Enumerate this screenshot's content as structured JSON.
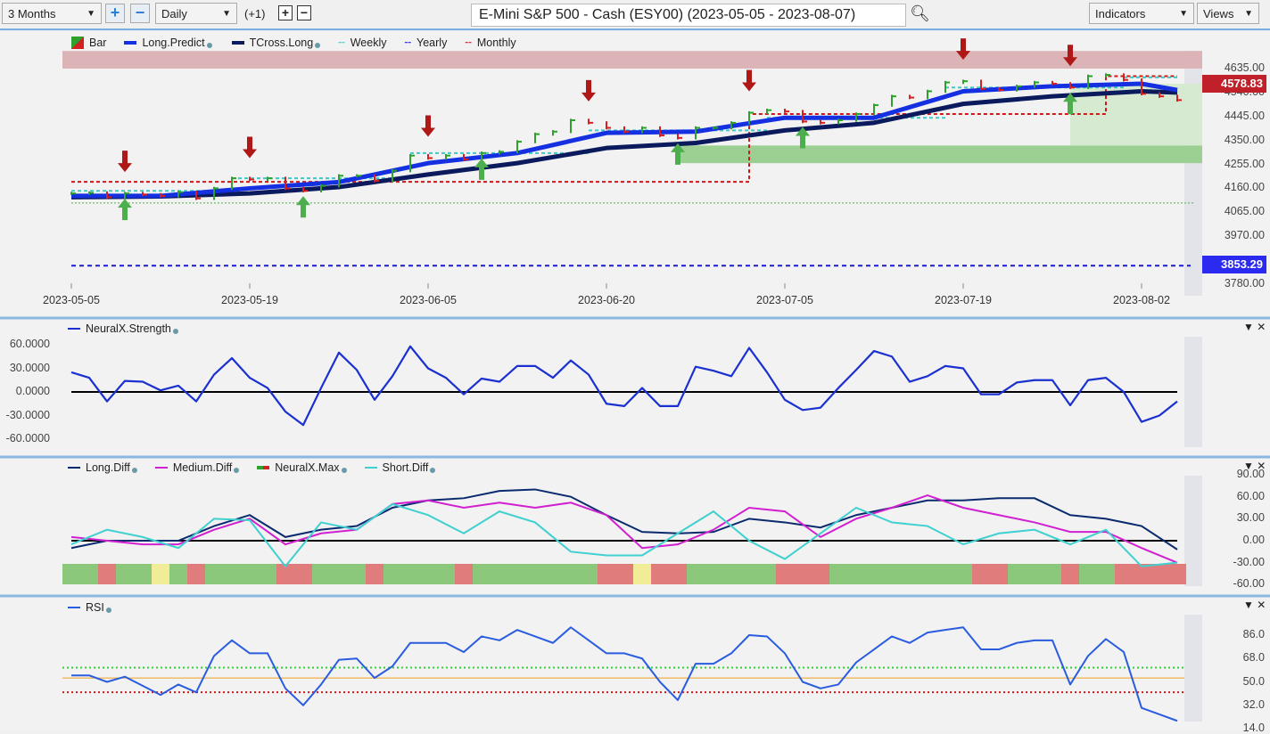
{
  "toolbar": {
    "range": "3 Months",
    "interval": "Daily",
    "offset": "(+1)",
    "title": "E-Mini S&P 500 - Cash (ESY00) (2023-05-05 - 2023-08-07)",
    "indicators": "Indicators",
    "views": "Views"
  },
  "colors": {
    "up": "#2ea02e",
    "down": "#d42020",
    "long_predict": "#1530e0",
    "tcross": "#0b1a5c",
    "weekly": "#40c8c8",
    "yearly": "#1a1ad0",
    "monthly": "#d01818",
    "long_diff": "#0b2a6e",
    "medium_diff": "#d020d0",
    "short_diff": "#40d0d0",
    "rsi": "#2a5ce0"
  },
  "chart_data": [
    {
      "type": "line",
      "panel": "price",
      "legend": [
        "Bar",
        "Long.Predict",
        "TCross.Long",
        "Weekly",
        "Yearly",
        "Monthly"
      ],
      "x_labels": [
        "2023-05-05",
        "2023-05-19",
        "2023-06-05",
        "2023-06-20",
        "2023-07-05",
        "2023-07-19",
        "2023-08-02"
      ],
      "x_label_index": [
        0,
        10,
        20,
        30,
        40,
        50,
        60
      ],
      "y_ticks": [
        "4635.00",
        "4540.00",
        "4445.00",
        "4350.00",
        "4255.00",
        "4160.00",
        "4065.00",
        "3970.00",
        "3780.00"
      ],
      "ylim": [
        3780,
        4635
      ],
      "close": [
        4140,
        4142,
        4125,
        4140,
        4135,
        4130,
        4145,
        4120,
        4160,
        4200,
        4195,
        4200,
        4160,
        4150,
        4170,
        4210,
        4210,
        4190,
        4230,
        4290,
        4280,
        4290,
        4275,
        4300,
        4305,
        4345,
        4375,
        4385,
        4430,
        4420,
        4400,
        4385,
        4400,
        4370,
        4360,
        4400,
        4400,
        4420,
        4460,
        4470,
        4465,
        4425,
        4420,
        4430,
        4455,
        4490,
        4525,
        4520,
        4545,
        4580,
        4585,
        4555,
        4550,
        4565,
        4580,
        4575,
        4560,
        4605,
        4610,
        4590,
        4535,
        4525,
        4510
      ],
      "long_predict": {
        "index": [
          0,
          5,
          10,
          15,
          20,
          25,
          30,
          35,
          40,
          45,
          50,
          55,
          60,
          62
        ],
        "values": [
          4130,
          4130,
          4160,
          4185,
          4260,
          4300,
          4380,
          4385,
          4440,
          4440,
          4545,
          4565,
          4575,
          4550
        ]
      },
      "tcross_long": {
        "index": [
          0,
          5,
          10,
          15,
          20,
          25,
          30,
          35,
          40,
          45,
          50,
          55,
          60,
          62
        ],
        "values": [
          4125,
          4128,
          4140,
          4165,
          4215,
          4260,
          4320,
          4340,
          4390,
          4420,
          4495,
          4525,
          4545,
          4540
        ]
      },
      "monthly": [
        {
          "from": 0,
          "to": 38,
          "value": 4186
        },
        {
          "from": 38,
          "to": 58,
          "value": 4455
        },
        {
          "from": 58,
          "to": 62,
          "value": 4605
        }
      ],
      "weekly": [
        {
          "from": 0,
          "to": 9,
          "value": 4150
        },
        {
          "from": 9,
          "to": 19,
          "value": 4200
        },
        {
          "from": 19,
          "to": 29,
          "value": 4300
        },
        {
          "from": 29,
          "to": 39,
          "value": 4390
        },
        {
          "from": 39,
          "to": 49,
          "value": 4440
        },
        {
          "from": 49,
          "to": 59,
          "value": 4560
        },
        {
          "from": 59,
          "to": 62,
          "value": 4600
        }
      ],
      "yearly": 3853.29,
      "support_line": 4102,
      "sell_signals": [
        3,
        10,
        20,
        29,
        38,
        50,
        56
      ],
      "buy_signals": [
        3,
        13,
        23,
        34,
        41,
        56
      ],
      "resistance_zone": [
        4635,
        4705
      ],
      "support_zone": {
        "from": 34,
        "low": 4260,
        "high": 4330
      },
      "last_price": "4578.83",
      "yearly_label": "3853.29"
    },
    {
      "type": "line",
      "panel": "strength",
      "legend": [
        "NeuralX.Strength"
      ],
      "y_ticks": [
        "60.0000",
        "30.0000",
        "0.0000",
        "-30.0000",
        "-60.0000"
      ],
      "ylim": [
        -60,
        60
      ],
      "values": [
        25,
        18,
        -12,
        14,
        13,
        2,
        8,
        -12,
        22,
        43,
        18,
        5,
        -25,
        -42,
        5,
        50,
        28,
        -10,
        20,
        58,
        30,
        18,
        -3,
        17,
        13,
        33,
        33,
        18,
        40,
        22,
        -15,
        -18,
        5,
        -18,
        -18,
        32,
        27,
        20,
        56,
        25,
        -10,
        -23,
        -20,
        5,
        28,
        52,
        45,
        13,
        20,
        33,
        30,
        -3,
        -3,
        12,
        15,
        15,
        -17,
        15,
        18,
        0,
        -38,
        -30,
        -12
      ]
    },
    {
      "type": "line",
      "panel": "diff",
      "legend": [
        "Long.Diff",
        "Medium.Diff",
        "NeuralX.Max",
        "Short.Diff"
      ],
      "y_ticks": [
        "90.00",
        "60.00",
        "30.00",
        "0.00",
        "-30.00",
        "-60.00"
      ],
      "ylim": [
        -60,
        90
      ],
      "series": [
        {
          "name": "Long.Diff",
          "values": [
            -10,
            0,
            0,
            0,
            20,
            35,
            5,
            15,
            20,
            45,
            55,
            58,
            68,
            70,
            60,
            35,
            12,
            10,
            12,
            30,
            25,
            18,
            35,
            45,
            55,
            55,
            58,
            58,
            35,
            30,
            20,
            -12
          ]
        },
        {
          "name": "Medium.Diff",
          "values": [
            5,
            0,
            -5,
            -5,
            15,
            30,
            -5,
            10,
            15,
            50,
            55,
            45,
            52,
            45,
            52,
            35,
            -10,
            -5,
            15,
            45,
            40,
            5,
            30,
            45,
            62,
            45,
            35,
            25,
            12,
            12,
            -10,
            -30
          ]
        },
        {
          "name": "Short.Diff",
          "values": [
            -5,
            15,
            5,
            -10,
            30,
            28,
            -35,
            25,
            15,
            50,
            35,
            10,
            40,
            25,
            -15,
            -20,
            -20,
            10,
            40,
            0,
            -25,
            10,
            45,
            25,
            20,
            -5,
            10,
            15,
            -5,
            15,
            -35,
            -30
          ]
        }
      ],
      "neuralx_max": "GGRGGYGRGGGGRRGGGRGGGGRGGGGGGGRRYRRGGGGGRRRGGGGGGGGRRGGGRGGRRRR"
    },
    {
      "type": "line",
      "panel": "rsi",
      "legend": [
        "RSI"
      ],
      "y_ticks": [
        "86.0",
        "68.0",
        "50.0",
        "32.0",
        "14.0"
      ],
      "ylim": [
        14,
        86
      ],
      "levels": {
        "upper": 61,
        "mid": 53,
        "lower": 42
      },
      "values": [
        55,
        55,
        50,
        54,
        47,
        40,
        48,
        42,
        70,
        82,
        72,
        72,
        45,
        32,
        48,
        67,
        68,
        53,
        62,
        80,
        80,
        80,
        73,
        85,
        82,
        90,
        85,
        80,
        92,
        82,
        72,
        72,
        68,
        50,
        36,
        64,
        64,
        72,
        86,
        85,
        72,
        50,
        45,
        48,
        65,
        75,
        85,
        80,
        88,
        90,
        92,
        75,
        75,
        80,
        82,
        82,
        48,
        70,
        83,
        73,
        30,
        25,
        20
      ]
    }
  ]
}
